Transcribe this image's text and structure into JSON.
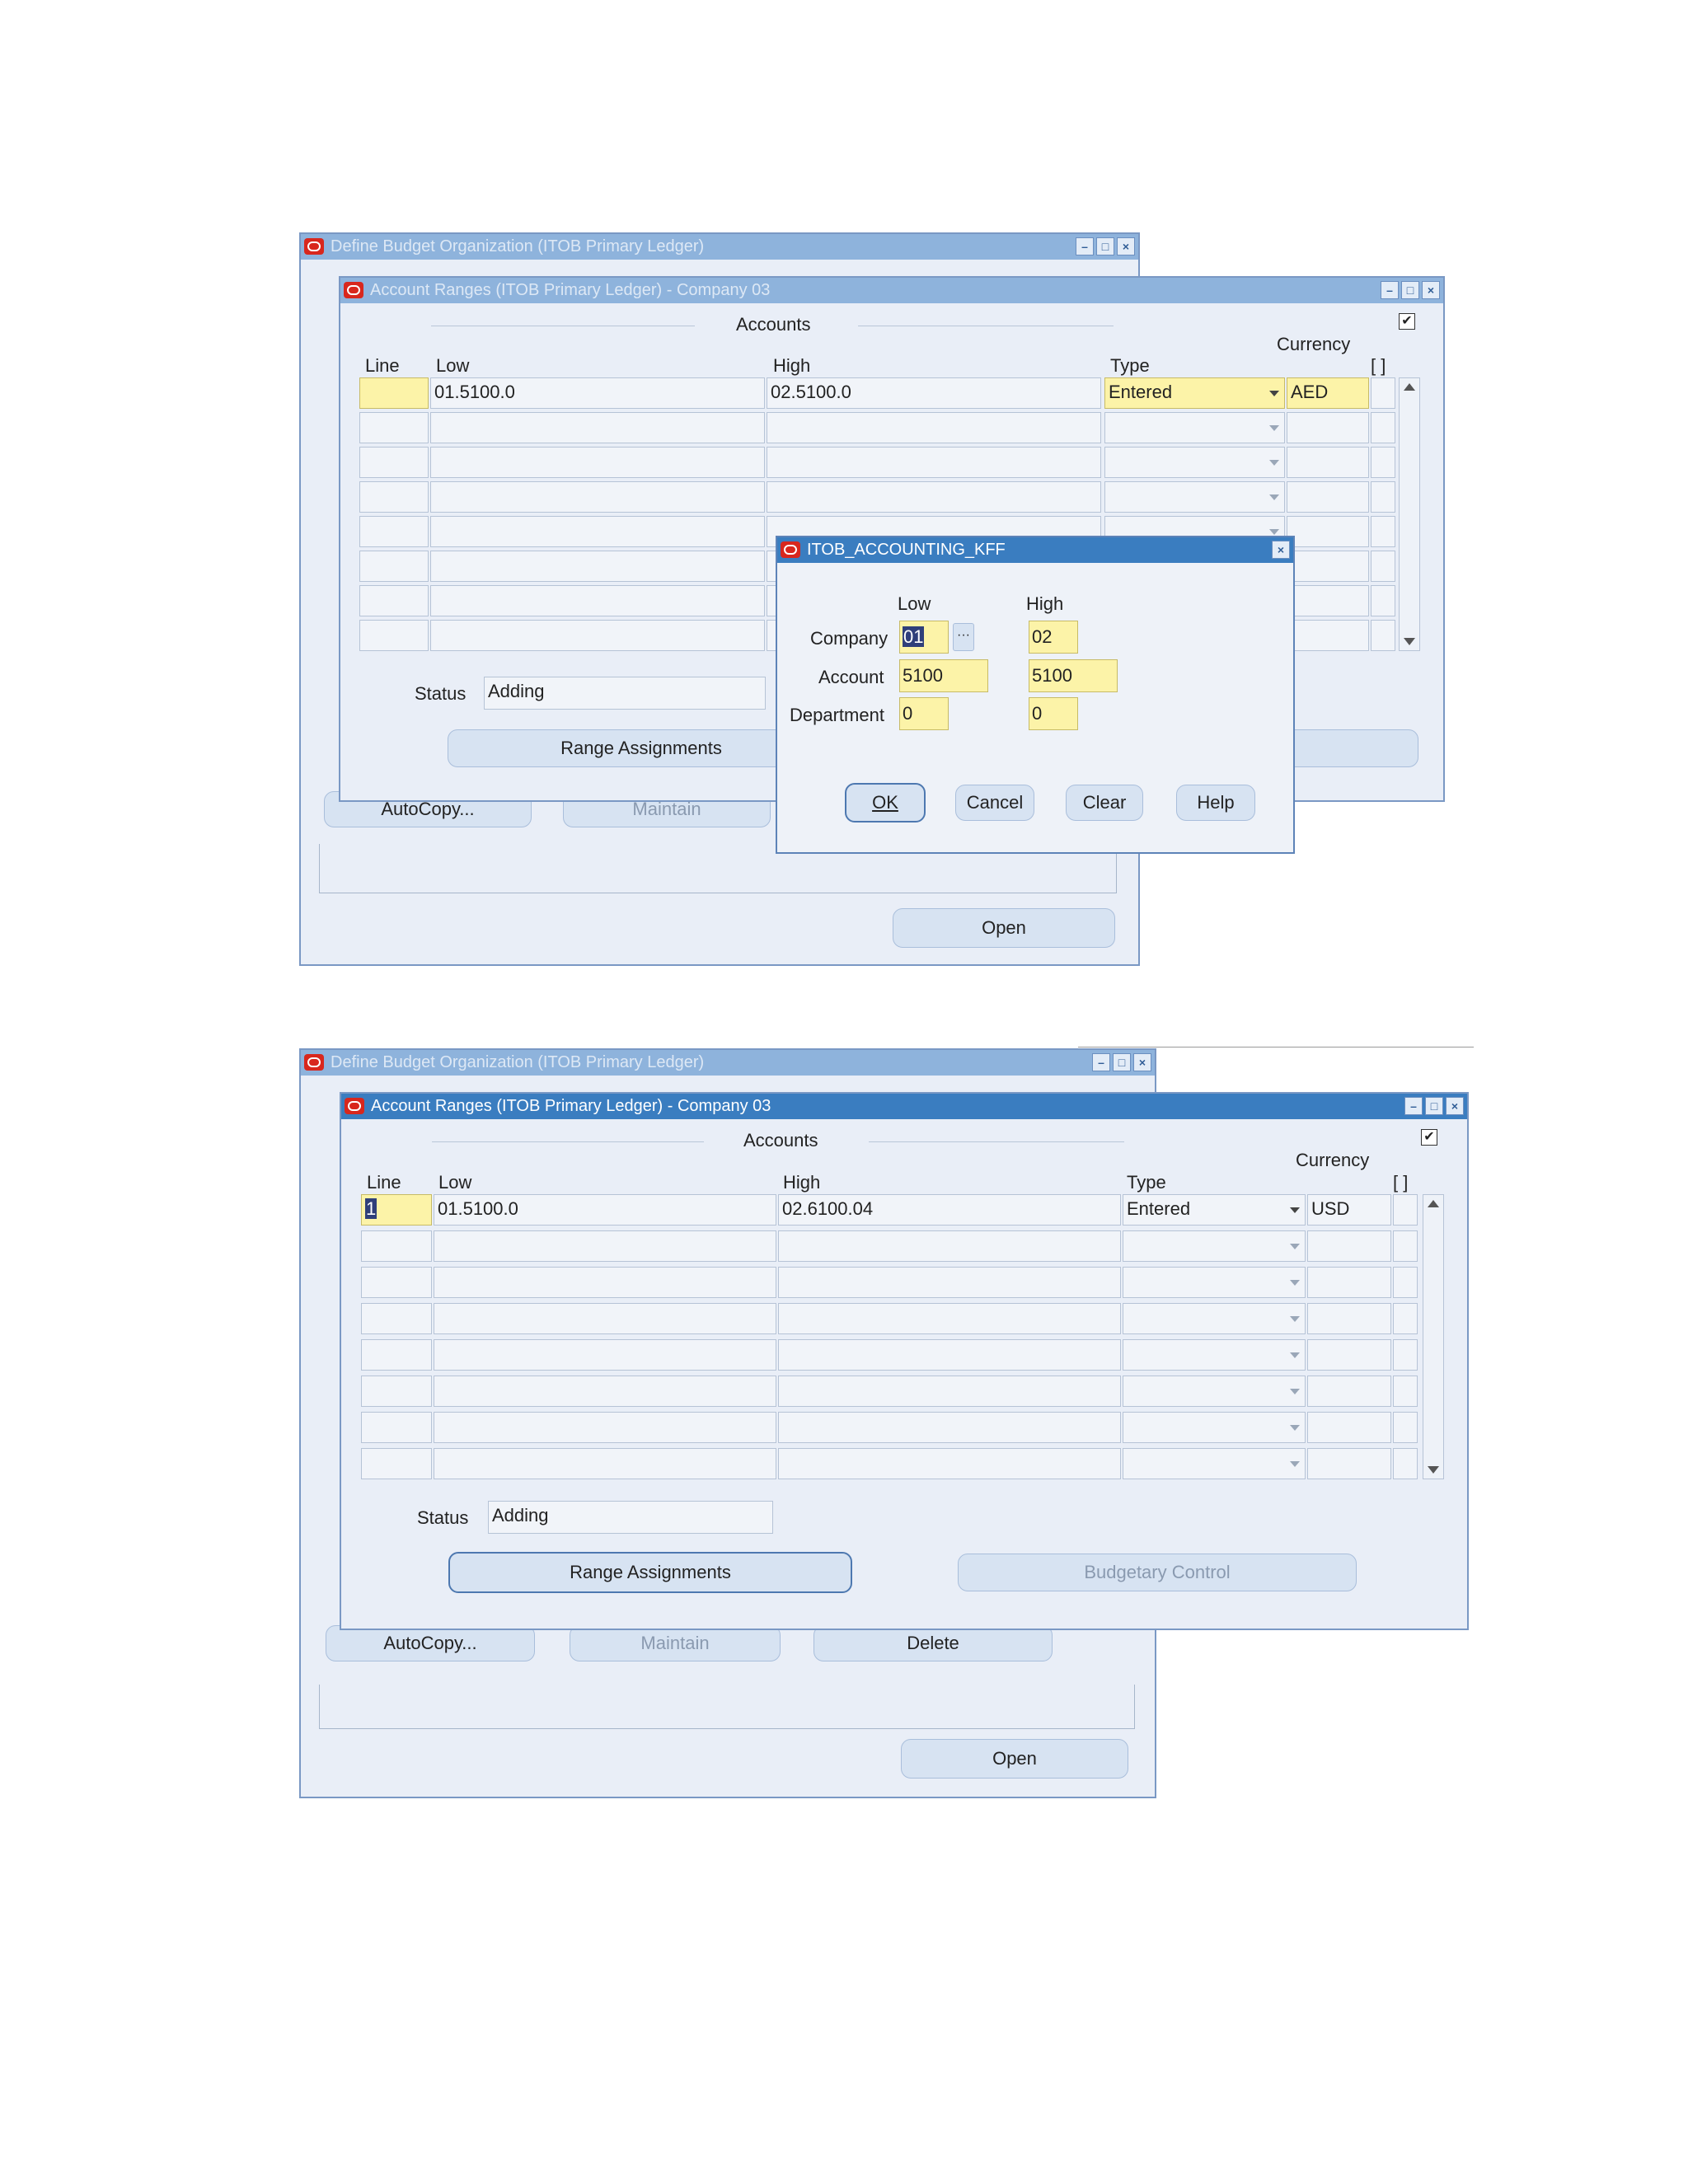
{
  "screen1": {
    "outer_window_title": "Define Budget Organization (ITOB Primary Ledger)",
    "inner_window_title": "Account Ranges (ITOB Primary Ledger) - Company 03",
    "section_title": "Accounts",
    "currency_header": "Currency",
    "columns": {
      "line": "Line",
      "low": "Low",
      "high": "High",
      "type": "Type",
      "desc": "[ ]"
    },
    "rows": [
      {
        "line": "",
        "low": "01.5100.0",
        "high": "02.5100.0",
        "type": "Entered",
        "currency": "AED"
      }
    ],
    "status_label": "Status",
    "status_value": "Adding",
    "range_assignments": "Range Assignments",
    "autocopy": "AutoCopy...",
    "maintain": "Maintain",
    "open": "Open",
    "kff": {
      "title": "ITOB_ACCOUNTING_KFF",
      "low_header": "Low",
      "high_header": "High",
      "fields": [
        {
          "label": "Company",
          "low": "01",
          "high": "02"
        },
        {
          "label": "Account",
          "low": "5100",
          "high": "5100"
        },
        {
          "label": "Department",
          "low": "0",
          "high": "0"
        }
      ],
      "ok": "OK",
      "cancel": "Cancel",
      "clear": "Clear",
      "help": "Help"
    }
  },
  "screen2": {
    "outer_window_title": "Define Budget Organization (ITOB Primary Ledger)",
    "inner_window_title": "Account Ranges (ITOB Primary Ledger) - Company 03",
    "section_title": "Accounts",
    "currency_header": "Currency",
    "columns": {
      "line": "Line",
      "low": "Low",
      "high": "High",
      "type": "Type",
      "desc": "[ ]"
    },
    "rows": [
      {
        "line": "1",
        "low": "01.5100.0",
        "high": "02.6100.04",
        "type": "Entered",
        "currency": "USD"
      }
    ],
    "status_label": "Status",
    "status_value": "Adding",
    "range_assignments": "Range Assignments",
    "budgetary_control": "Budgetary Control",
    "autocopy": "AutoCopy...",
    "maintain": "Maintain",
    "delete": "Delete",
    "open": "Open"
  }
}
